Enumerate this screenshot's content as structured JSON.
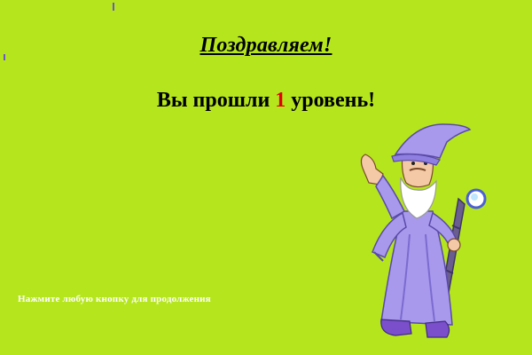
{
  "screen": {
    "title": "Поздравляем!",
    "message_prefix": "Вы прошли ",
    "level": "1",
    "message_suffix": " уровень!",
    "hint": "Нажмите любую кнопку для продолжения"
  },
  "colors": {
    "background": "#b5e61d",
    "level_number": "#e00000",
    "hint_text": "#ffffff",
    "wizard_robe": "#a899ec"
  },
  "icons": {
    "character": "wizard-with-staff"
  }
}
